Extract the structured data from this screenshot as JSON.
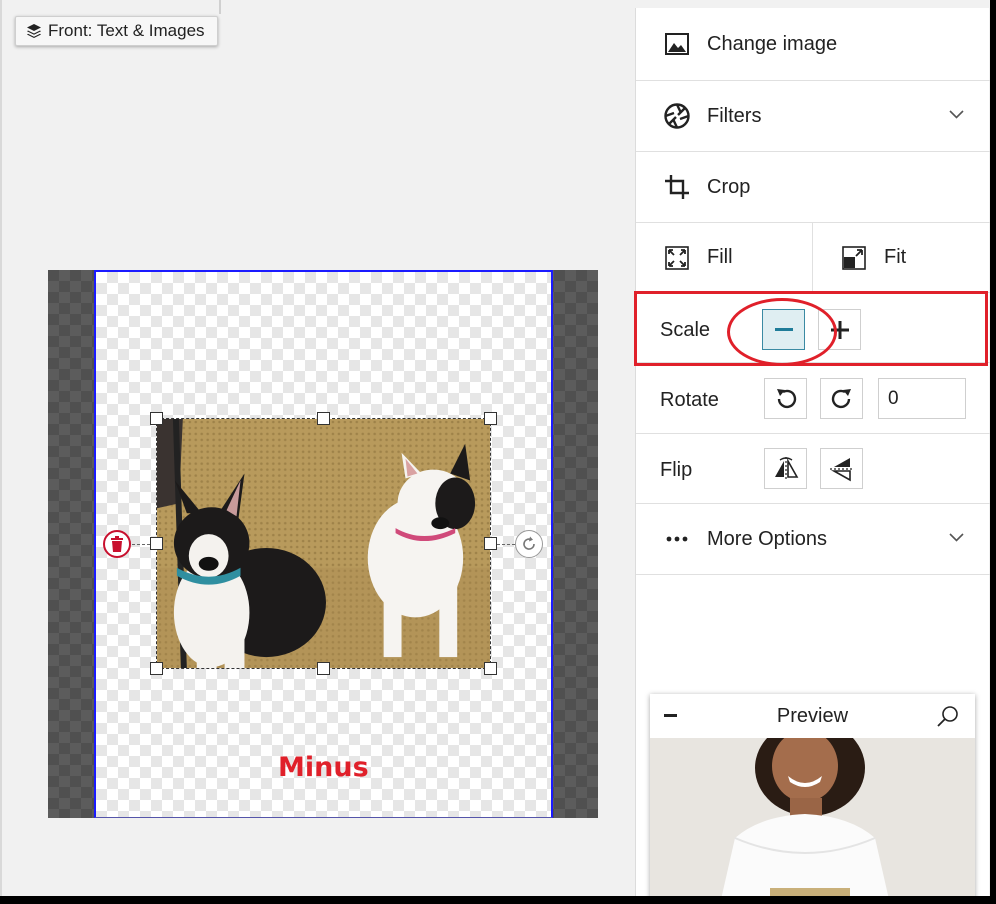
{
  "layer_badge": {
    "label": "Front: Text & Images",
    "icon": "layers-icon"
  },
  "canvas": {
    "annotation": "Minus"
  },
  "panel": {
    "change_image": {
      "label": "Change image",
      "icon": "image-icon"
    },
    "filters": {
      "label": "Filters",
      "icon": "aperture-icon"
    },
    "crop": {
      "label": "Crop",
      "icon": "crop-icon"
    },
    "fill": {
      "label": "Fill",
      "icon": "expand-icon"
    },
    "fit": {
      "label": "Fit",
      "icon": "fit-icon"
    },
    "scale": {
      "label": "Scale",
      "minus_icon": "minus-icon",
      "plus_icon": "plus-icon"
    },
    "rotate": {
      "label": "Rotate",
      "value": "0"
    },
    "flip": {
      "label": "Flip"
    },
    "more_options": {
      "label": "More Options",
      "icon": "more-horizontal-icon"
    }
  },
  "preview": {
    "title": "Preview"
  },
  "colors": {
    "accent": "#3a8aa3",
    "highlight": "#e0202a",
    "guide": "#1a1aff"
  }
}
